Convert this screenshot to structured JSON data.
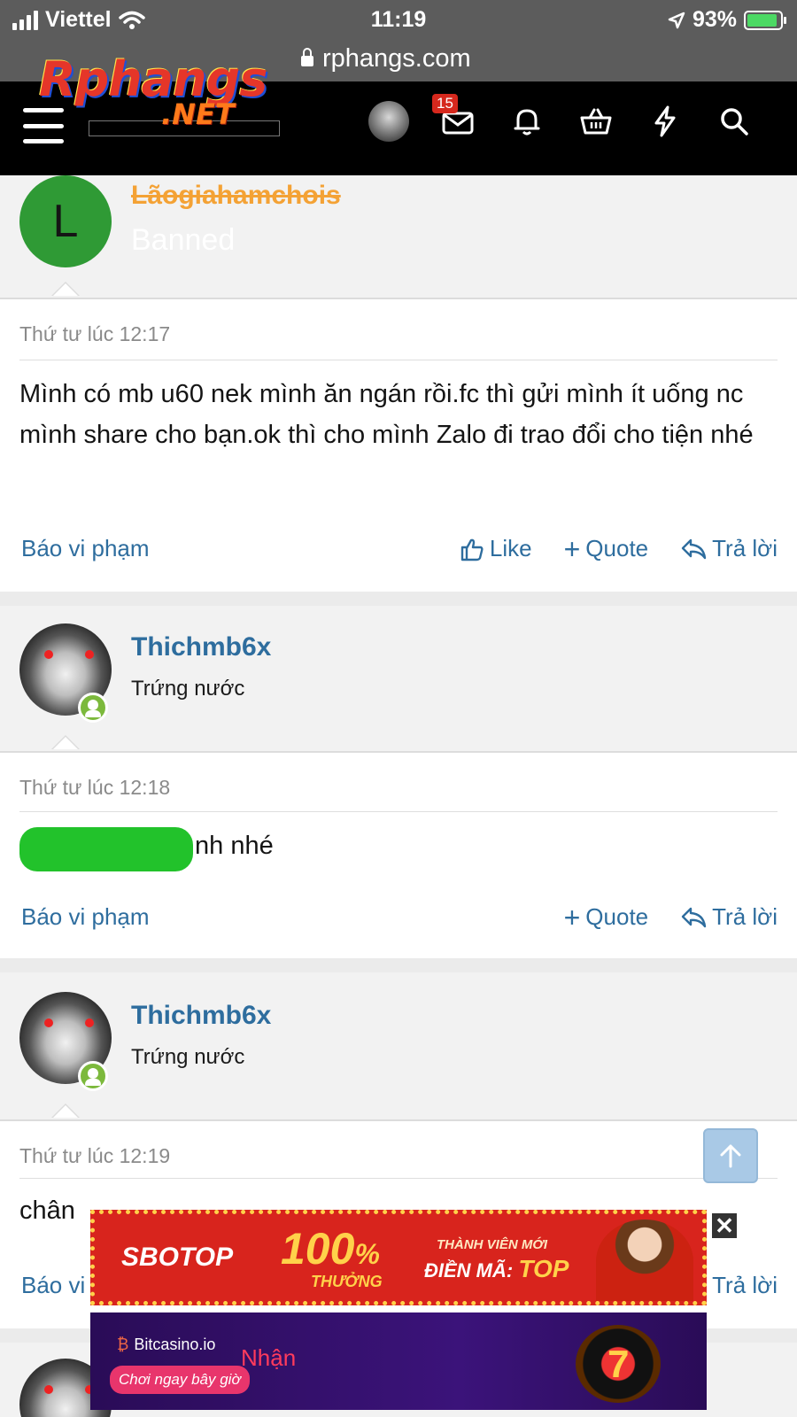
{
  "status_bar": {
    "carrier": "Viettel",
    "time": "11:19",
    "battery": "93%"
  },
  "browser": {
    "url": "rphangs.com"
  },
  "site": {
    "logo_main": "Rphangs",
    "logo_sub": ".NET",
    "notification_count": "15"
  },
  "posts": [
    {
      "user": {
        "initial": "L",
        "name": "Lãogiahamchois",
        "title": "Banned"
      },
      "time": "Thứ tư lúc 12:17",
      "text": "Mình có mb u60 nek mình ăn ngán rồi.fc thì gửi mình ít uống nc mình share cho bạn.ok thì cho mình Zalo đi trao đổi cho tiện nhé",
      "actions": {
        "report": "Báo vi phạm",
        "like": "Like",
        "quote": "Quote",
        "reply": "Trả lời"
      }
    },
    {
      "user": {
        "name": "Thichmb6x",
        "title": "Trứng nước"
      },
      "time": "Thứ tư lúc 12:18",
      "text": "nh nhé",
      "actions": {
        "report": "Báo vi phạm",
        "quote": "Quote",
        "reply": "Trả lời"
      }
    },
    {
      "user": {
        "name": "Thichmb6x",
        "title": "Trứng nước"
      },
      "time": "Thứ tư lúc 12:19",
      "text": "chân",
      "actions": {
        "report": "Báo vi",
        "reply": "Trả lời"
      }
    },
    {
      "user": {
        "name": "",
        "title": ""
      }
    }
  ],
  "ads": [
    {
      "brand": "SBOTOP",
      "headline": "100",
      "percent": "%",
      "bonus": "THƯỞNG",
      "new_member": "THÀNH VIÊN MỚI",
      "code_label": "ĐIỀN MÃ:",
      "code": "TOP"
    },
    {
      "brand": "Bitcasino.io",
      "headline": "Nhận",
      "cta": "Chơi ngay bây giờ"
    }
  ],
  "colors": {
    "link_blue": "#2e6d9e",
    "banned_orange": "#f4a235",
    "online_green": "#7cb93c",
    "header_black": "#000000"
  }
}
